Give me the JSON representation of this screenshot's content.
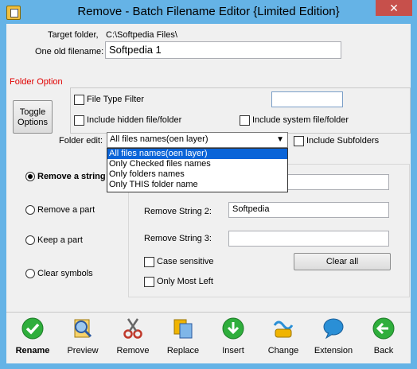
{
  "window": {
    "title": "Remove - Batch Filename Editor {Limited Edition}",
    "close_label": "✕"
  },
  "target": {
    "label": "Target folder,",
    "path": "C:\\Softpedia Files\\"
  },
  "old_filename": {
    "label": "One old filename:",
    "value": "Softpedia 1"
  },
  "folder_option": {
    "title": "Folder Option",
    "toggle_label": "Toggle Options",
    "file_type_filter": "File Type Filter",
    "include_hidden": "Include hidden file/folder",
    "include_system": "Include system file/folder",
    "folder_edit_label": "Folder edit:",
    "folder_edit_value": "All files names(oen layer)",
    "include_subfolders": "Include Subfolders",
    "dropdown_options": [
      "All files names(oen layer)",
      "Only Checked files names",
      "Only folders names",
      "Only THIS folder name"
    ]
  },
  "modes": {
    "remove_string": "Remove a string",
    "remove_part": "Remove a part",
    "keep_part": "Keep a part",
    "clear_symbols": "Clear symbols"
  },
  "strings": {
    "string2_label": "Remove String 2:",
    "string2_value": "Softpedia",
    "string3_label": "Remove String 3:",
    "string3_value": "",
    "case_sensitive": "Case sensitive",
    "clear_all": "Clear all",
    "only_most_left": "Only Most Left"
  },
  "toolbar": {
    "items": [
      {
        "label": "Rename",
        "icon": "check-icon",
        "color": "#2fae3c"
      },
      {
        "label": "Preview",
        "icon": "magnifier-icon",
        "color": "#3a6fc4"
      },
      {
        "label": "Remove",
        "icon": "scissors-icon",
        "color": "#c0392b"
      },
      {
        "label": "Replace",
        "icon": "replace-icon",
        "color": "#f0b400"
      },
      {
        "label": "Insert",
        "icon": "insert-down-icon",
        "color": "#2fae3c"
      },
      {
        "label": "Change",
        "icon": "change-icon",
        "color": "#2a8fd6"
      },
      {
        "label": "Extension",
        "icon": "speech-bubble-icon",
        "color": "#2a8fd6"
      },
      {
        "label": "Back",
        "icon": "back-arrow-icon",
        "color": "#2fae3c"
      }
    ]
  }
}
